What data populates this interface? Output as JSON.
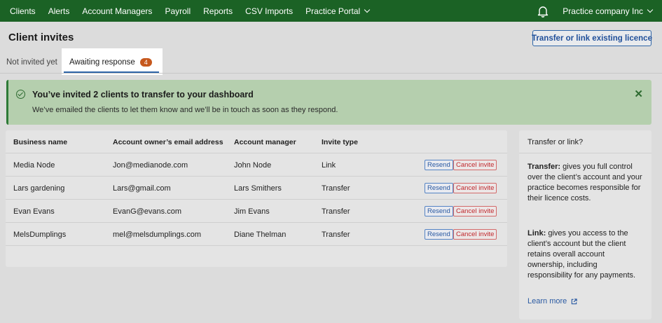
{
  "nav": {
    "items": [
      "Clients",
      "Alerts",
      "Account Managers",
      "Payroll",
      "Reports",
      "CSV Imports"
    ],
    "portal_label": "Practice Portal",
    "company_label": "Practice company Inc"
  },
  "header": {
    "title": "Client invites",
    "transfer_button": "Transfer or link existing licence"
  },
  "tabs": {
    "inactive_label": "Not invited yet",
    "active_label": "Awaiting response",
    "active_count": "4"
  },
  "banner": {
    "title": "You’ve invited 2 clients to transfer to your dashboard",
    "text": "We’ve emailed the clients to let them know and we’ll be in touch as soon as they respond."
  },
  "table": {
    "headers": [
      "Business name",
      "Account owner’s email address",
      "Account manager",
      "Invite type"
    ],
    "rows": [
      {
        "business": "Media Node",
        "email": "Jon@medianode.com",
        "manager": "John Node",
        "type": "Link"
      },
      {
        "business": "Lars gardening",
        "email": "Lars@gmail.com",
        "manager": "Lars Smithers",
        "type": "Transfer"
      },
      {
        "business": "Evan Evans",
        "email": "EvanG@evans.com",
        "manager": "Jim Evans",
        "type": "Transfer"
      },
      {
        "business": "MelsDumplings",
        "email": "mel@melsdumplings.com",
        "manager": "Diane Thelman",
        "type": "Transfer"
      }
    ],
    "resend_label": "Resend",
    "cancel_label": "Cancel invite"
  },
  "side": {
    "title": "Transfer or link?",
    "transfer_term": "Transfer:",
    "transfer_text": " gives you full control over the client’s account and your practice becomes responsible for their licence costs.",
    "link_term": "Link:",
    "link_text": " gives you access to the client’s account but the client retains overall account ownership, including responsibility for any payments.",
    "learn_more": "Learn more"
  },
  "colors": {
    "nav_bg": "#1b6225",
    "accent_blue": "#2f66a8",
    "badge": "#c6581d",
    "success_bg": "#b5cfae",
    "danger": "#c0282d"
  }
}
